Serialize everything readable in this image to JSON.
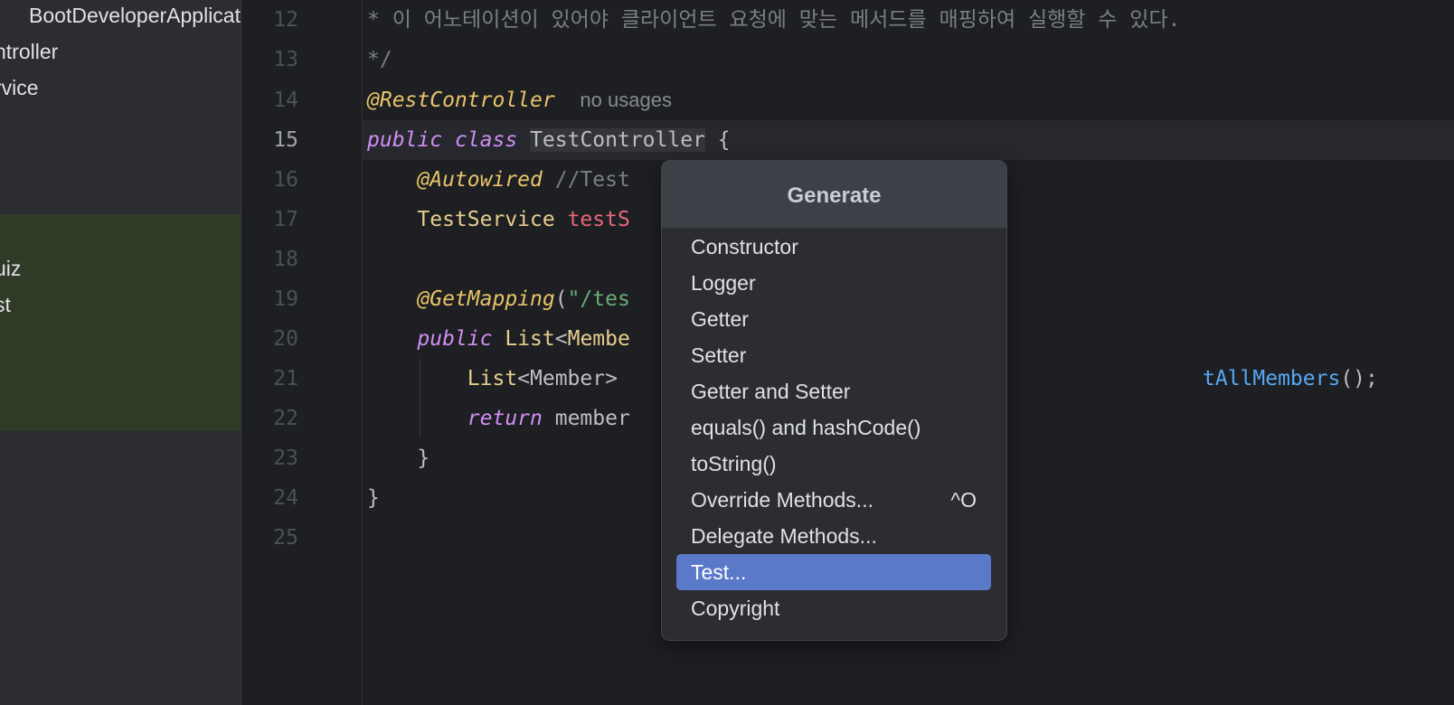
{
  "project_tree": {
    "items": [
      {
        "label": "BootDeveloperApplicat"
      },
      {
        "label": "ntroller"
      },
      {
        "label": "rvice"
      },
      {
        "label": "uiz"
      },
      {
        "label": "st"
      }
    ]
  },
  "editor": {
    "line_numbers": [
      "12",
      "13",
      "14",
      "15",
      "16",
      "17",
      "18",
      "19",
      "20",
      "21",
      "22",
      "23",
      "24",
      "25"
    ],
    "active_line": "15",
    "lines": {
      "l12": {
        "comment": "* 이 어노테이션이 있어야 클라이언트 요청에 맞는 메서드를 매핑하여 실행할 수 있다."
      },
      "l13": {
        "comment": "*/"
      },
      "l14": {
        "annotation": "@RestController",
        "hint": "no usages"
      },
      "l15": {
        "kw1": "public",
        "kw2": "class",
        "class_name": "TestController",
        "brace": "{"
      },
      "l16": {
        "annotation": "@Autowired",
        "comment": "//Test"
      },
      "l17": {
        "type": "TestService",
        "field": "testS"
      },
      "l19": {
        "annotation": "@GetMapping",
        "paren": "(",
        "string": "\"/tes"
      },
      "l20": {
        "kw": "public",
        "type": "List",
        "lt": "<",
        "type2": "Membe"
      },
      "l21": {
        "type": "List",
        "generic": "<Member>",
        "method": "tAllMembers",
        "tail": "();"
      },
      "l22": {
        "kw": "return",
        "text": "member"
      },
      "l23": {
        "brace": "}"
      },
      "l24": {
        "brace": "}"
      }
    }
  },
  "generate_popup": {
    "title": "Generate",
    "items": [
      {
        "label": "Constructor",
        "shortcut": ""
      },
      {
        "label": "Logger",
        "shortcut": ""
      },
      {
        "label": "Getter",
        "shortcut": ""
      },
      {
        "label": "Setter",
        "shortcut": ""
      },
      {
        "label": "Getter and Setter",
        "shortcut": ""
      },
      {
        "label": "equals() and hashCode()",
        "shortcut": ""
      },
      {
        "label": "toString()",
        "shortcut": ""
      },
      {
        "label": "Override Methods...",
        "shortcut": "^O"
      },
      {
        "label": "Delegate Methods...",
        "shortcut": ""
      },
      {
        "label": "Test...",
        "shortcut": ""
      },
      {
        "label": "Copyright",
        "shortcut": ""
      }
    ],
    "selected_label": "Test..."
  },
  "colors": {
    "selection": "#5a79c9",
    "annotation": "#e8c46a",
    "keyword": "#cf8ef4",
    "string": "#6aab73",
    "method": "#56a8f5",
    "field": "#e6687a"
  }
}
